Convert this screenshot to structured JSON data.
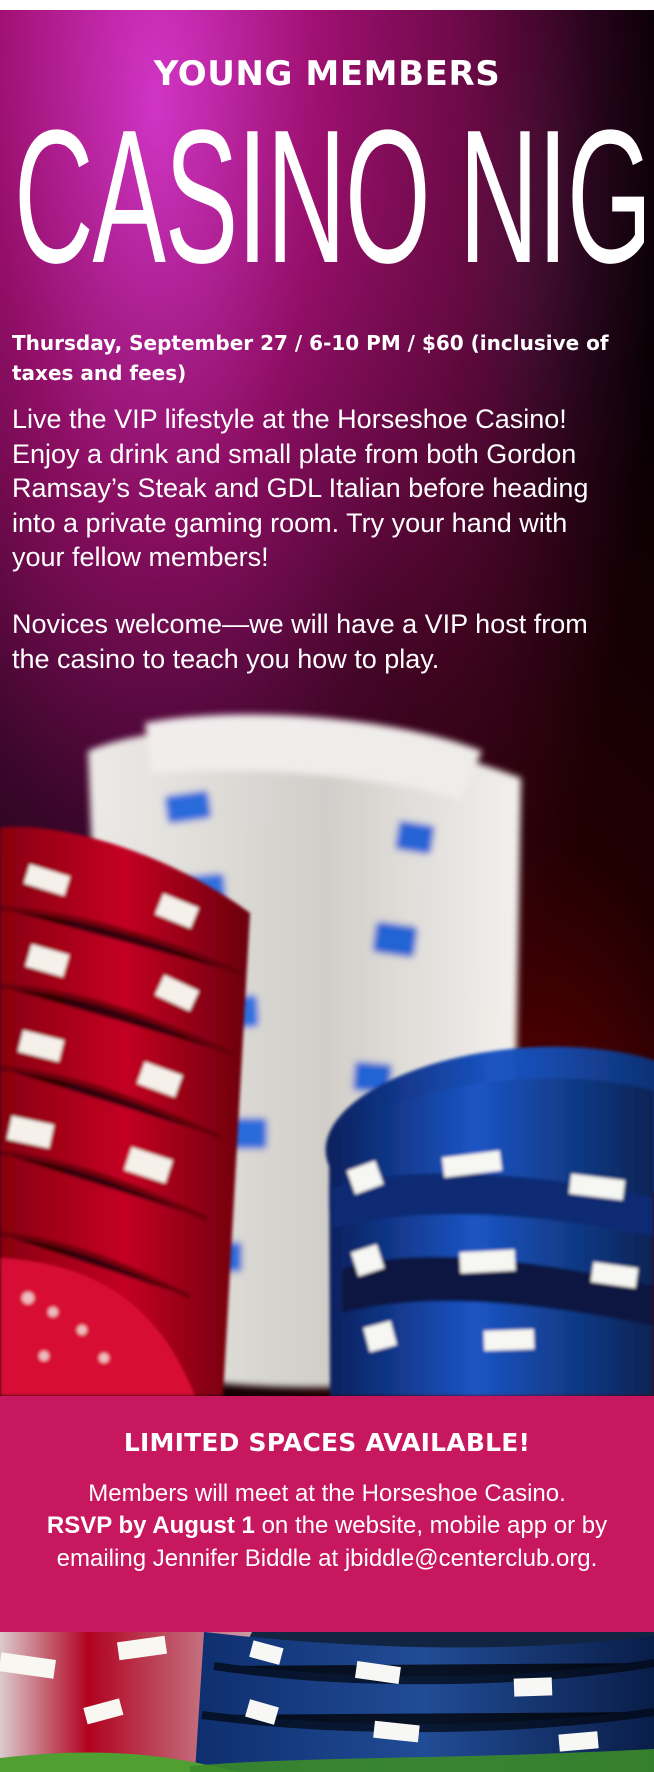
{
  "flyer": {
    "kicker": "YOUNG MEMBERS",
    "title": "CASINO NIGHT",
    "event_meta": "Thursday, September 27 / 6-10 PM / $60 (inclusive of taxes and fees)",
    "description": "Live the VIP lifestyle at the Horseshoe Casino! Enjoy a drink and small plate from both Gordon Ramsay’s Steak and GDL Italian before heading into a private gaming room. Try your hand with your fellow members!",
    "note": "Novices welcome—we will have a VIP host from the casino to teach you how to play."
  },
  "rsvp_band": {
    "title": "LIMITED SPACES AVAILABLE!",
    "line_1": "Members will meet at the Horseshoe Casino.",
    "rsvp_bold": "RSVP by August 1",
    "rsvp_rest": " on the website, mobile app or by emailing Jennifer Biddle at jbiddle@centerclub.org."
  },
  "colors": {
    "band": "#c6175f",
    "text": "#ffffff",
    "red_chip": "#b9001e",
    "blue_chip": "#1747a8"
  }
}
